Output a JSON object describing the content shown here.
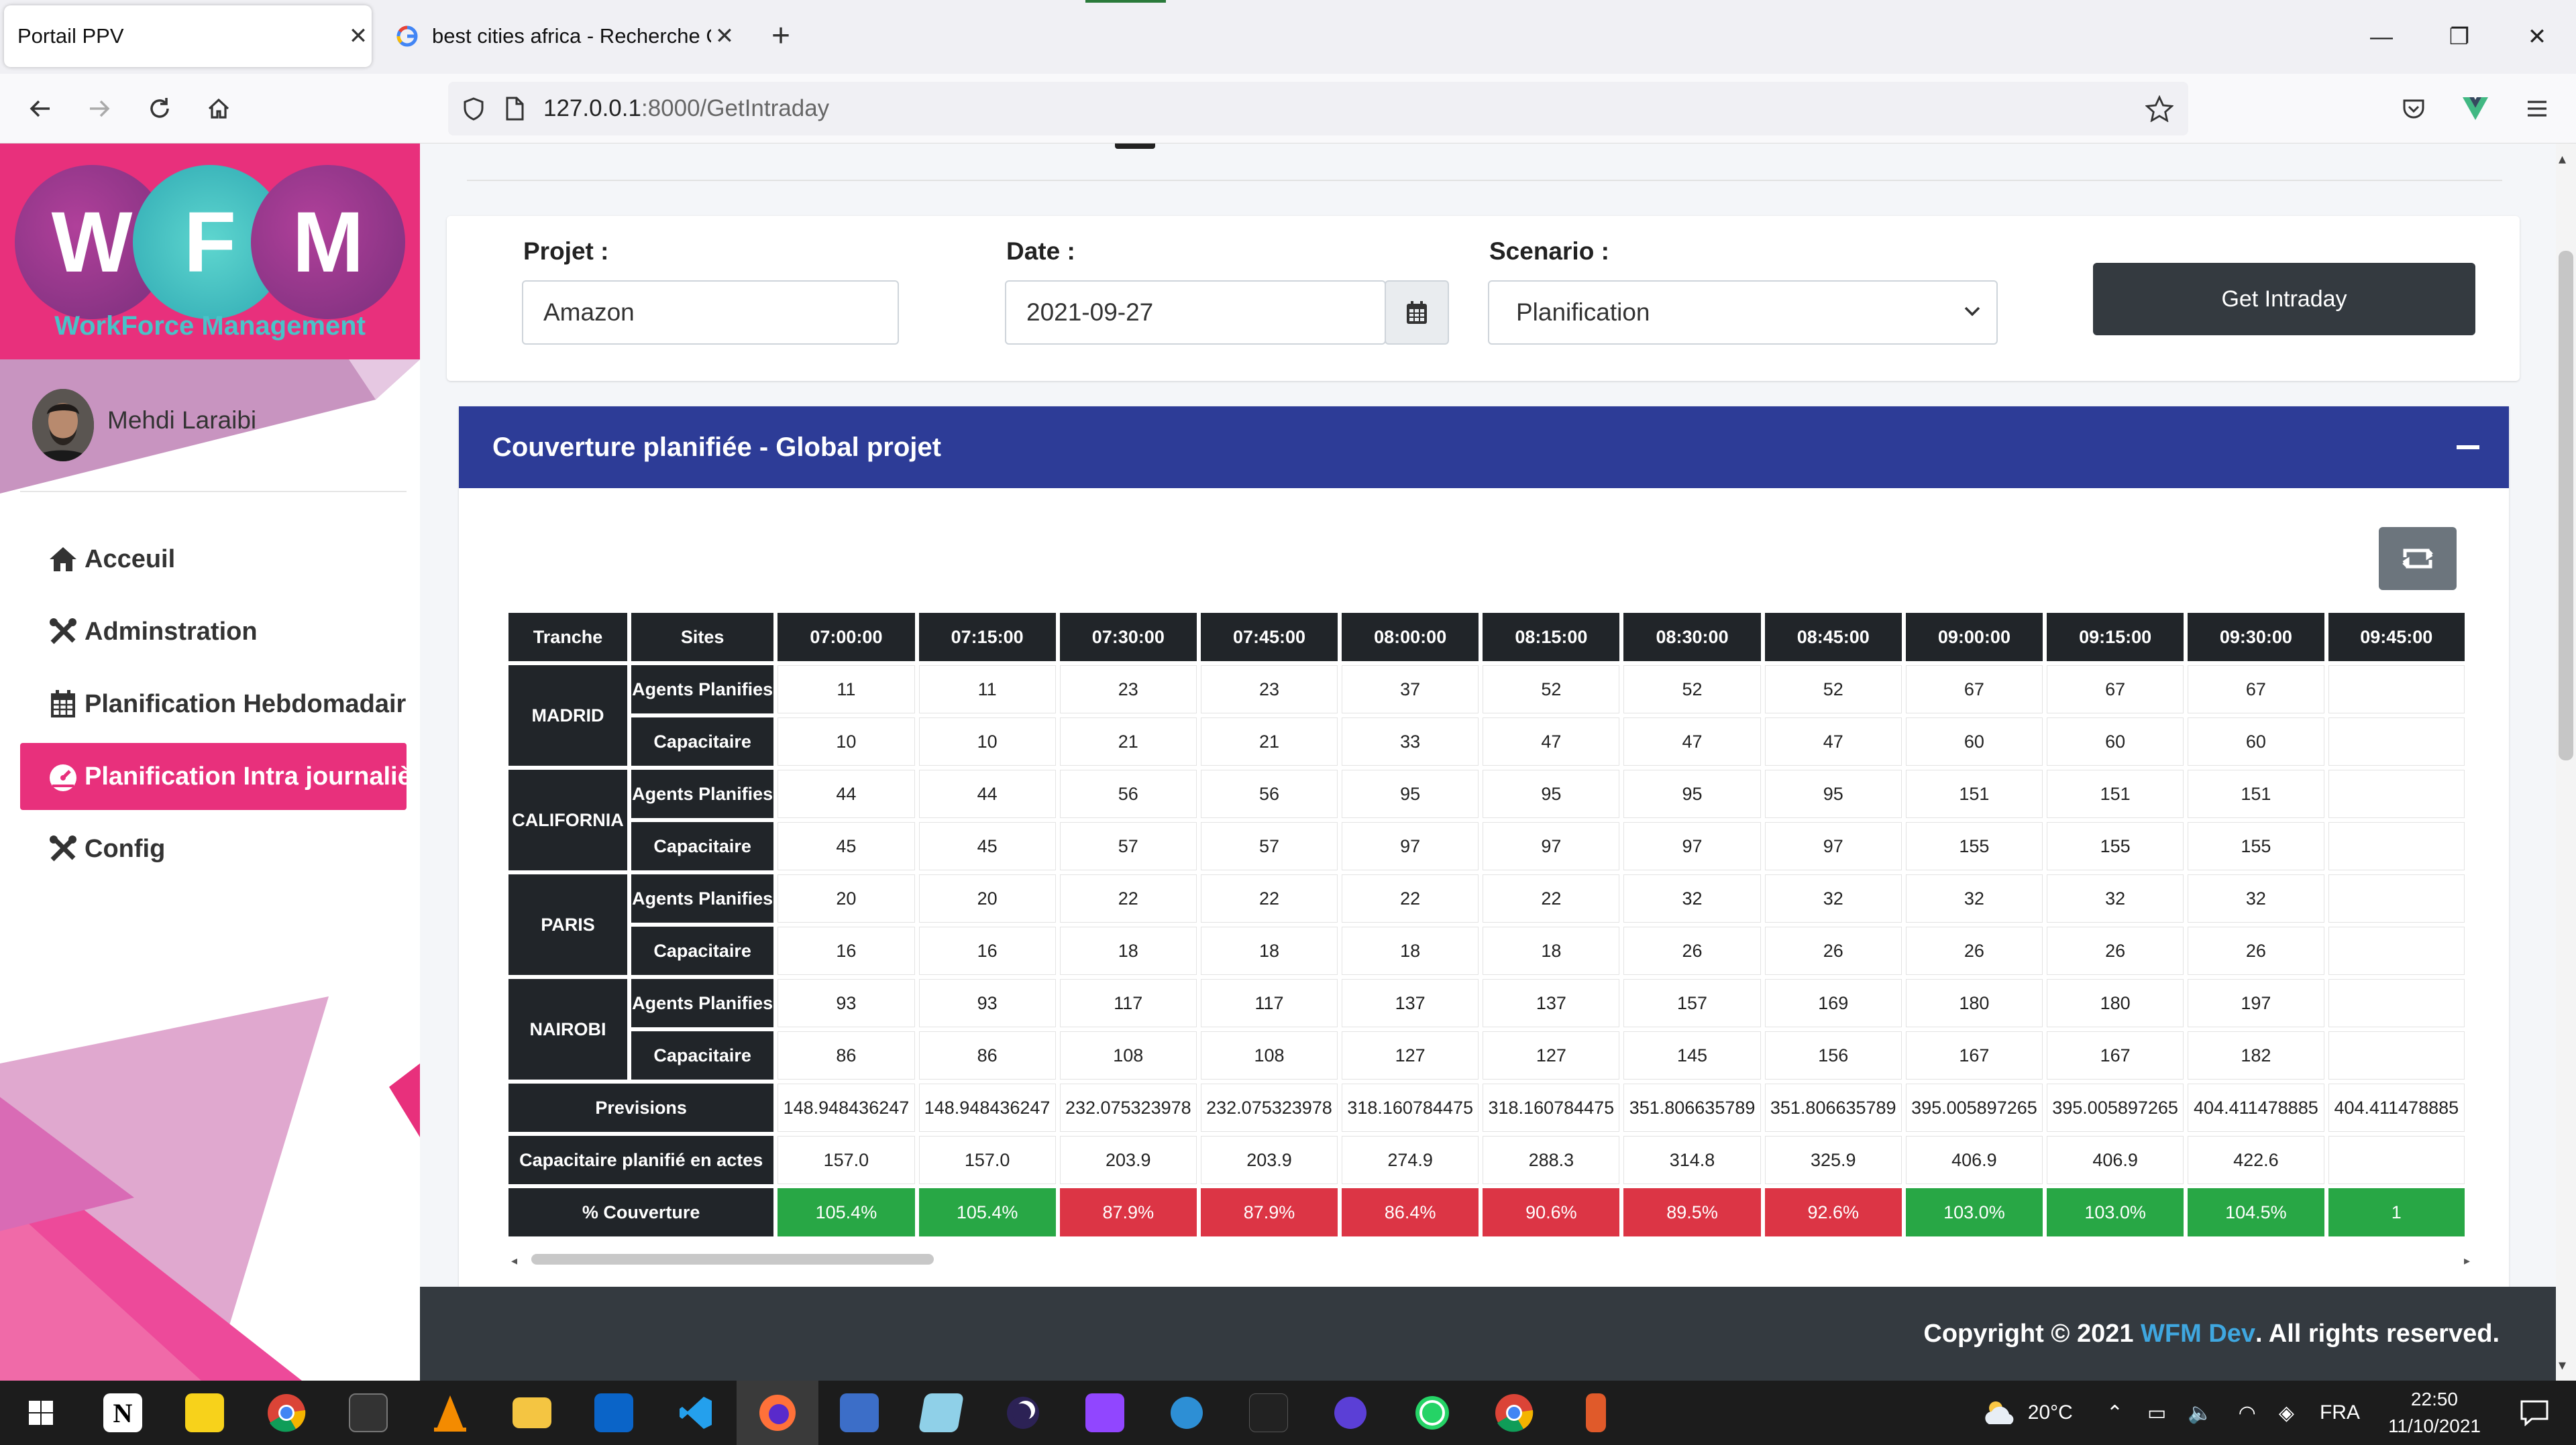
{
  "browser": {
    "tabs": [
      {
        "title": "Portail PPV"
      },
      {
        "title": "best cities africa - Recherche Go"
      }
    ],
    "url_host": "127.0.0.1",
    "url_rest": ":8000/GetIntraday"
  },
  "sidebar": {
    "brand_letters": [
      "W",
      "F",
      "M"
    ],
    "brand_subtitle": "WorkForce Management",
    "user_name": "Mehdi Laraibi",
    "items": [
      {
        "label": "Acceuil",
        "icon": "home-icon"
      },
      {
        "label": "Adminstration",
        "icon": "tools-icon"
      },
      {
        "label": "Planification Hebdomadaire",
        "icon": "calendar-icon"
      },
      {
        "label": "Planification Intra journalière",
        "icon": "gauge-icon",
        "active": true
      },
      {
        "label": "Config",
        "icon": "tools-icon"
      }
    ]
  },
  "filter": {
    "projet_label": "Projet :",
    "projet_value": "Amazon",
    "date_label": "Date :",
    "date_value": "2021-09-27",
    "scenario_label": "Scenario :",
    "scenario_value": "Planification",
    "button_label": "Get Intraday"
  },
  "card": {
    "title": "Couverture planifiée - Global projet"
  },
  "table": {
    "header_tranche": "Tranche",
    "header_sites": "Sites",
    "times": [
      "07:00:00",
      "07:15:00",
      "07:30:00",
      "07:45:00",
      "08:00:00",
      "08:15:00",
      "08:30:00",
      "08:45:00",
      "09:00:00",
      "09:15:00",
      "09:30:00",
      "09:45:00"
    ],
    "row_label_agents": "Agents Planifies",
    "row_label_cap": "Capacitaire",
    "sites": [
      {
        "name": "MADRID",
        "agents": [
          "11",
          "11",
          "23",
          "23",
          "37",
          "52",
          "52",
          "52",
          "67",
          "67",
          "67",
          ""
        ],
        "cap": [
          "10",
          "10",
          "21",
          "21",
          "33",
          "47",
          "47",
          "47",
          "60",
          "60",
          "60",
          ""
        ]
      },
      {
        "name": "CALIFORNIA",
        "agents": [
          "44",
          "44",
          "56",
          "56",
          "95",
          "95",
          "95",
          "95",
          "151",
          "151",
          "151",
          ""
        ],
        "cap": [
          "45",
          "45",
          "57",
          "57",
          "97",
          "97",
          "97",
          "97",
          "155",
          "155",
          "155",
          ""
        ]
      },
      {
        "name": "PARIS",
        "agents": [
          "20",
          "20",
          "22",
          "22",
          "22",
          "22",
          "32",
          "32",
          "32",
          "32",
          "32",
          ""
        ],
        "cap": [
          "16",
          "16",
          "18",
          "18",
          "18",
          "18",
          "26",
          "26",
          "26",
          "26",
          "26",
          ""
        ]
      },
      {
        "name": "NAIROBI",
        "agents": [
          "93",
          "93",
          "117",
          "117",
          "137",
          "137",
          "157",
          "169",
          "180",
          "180",
          "197",
          ""
        ],
        "cap": [
          "86",
          "86",
          "108",
          "108",
          "127",
          "127",
          "145",
          "156",
          "167",
          "167",
          "182",
          ""
        ]
      }
    ],
    "previsions_label": "Previsions",
    "previsions": [
      "148.948436247",
      "148.948436247",
      "232.075323978",
      "232.075323978",
      "318.160784475",
      "318.160784475",
      "351.806635789",
      "351.806635789",
      "395.005897265",
      "395.005897265",
      "404.411478885",
      "404.411478885"
    ],
    "cap_actes_label": "Capacitaire planifié en actes",
    "cap_actes": [
      "157.0",
      "157.0",
      "203.9",
      "203.9",
      "274.9",
      "288.3",
      "314.8",
      "325.9",
      "406.9",
      "406.9",
      "422.6",
      ""
    ],
    "couverture_label": "% Couverture",
    "couverture": [
      {
        "v": "105.4%",
        "ok": true
      },
      {
        "v": "105.4%",
        "ok": true
      },
      {
        "v": "87.9%",
        "ok": false
      },
      {
        "v": "87.9%",
        "ok": false
      },
      {
        "v": "86.4%",
        "ok": false
      },
      {
        "v": "90.6%",
        "ok": false
      },
      {
        "v": "89.5%",
        "ok": false
      },
      {
        "v": "92.6%",
        "ok": false
      },
      {
        "v": "103.0%",
        "ok": true
      },
      {
        "v": "103.0%",
        "ok": true
      },
      {
        "v": "104.5%",
        "ok": true
      },
      {
        "v": "1",
        "ok": true
      }
    ]
  },
  "footer": {
    "prefix": "Copyright © 2021 ",
    "brand": "WFM Dev",
    "suffix": ". All rights reserved."
  },
  "taskbar": {
    "weather": "20°C",
    "lang": "FRA",
    "time": "22:50",
    "date": "11/10/2021"
  },
  "colors": {
    "brand_pink": "#e8307c",
    "header_blue": "#2d3c97",
    "ok_green": "#28a745",
    "bad_red": "#dc3545",
    "dark": "#212529"
  }
}
